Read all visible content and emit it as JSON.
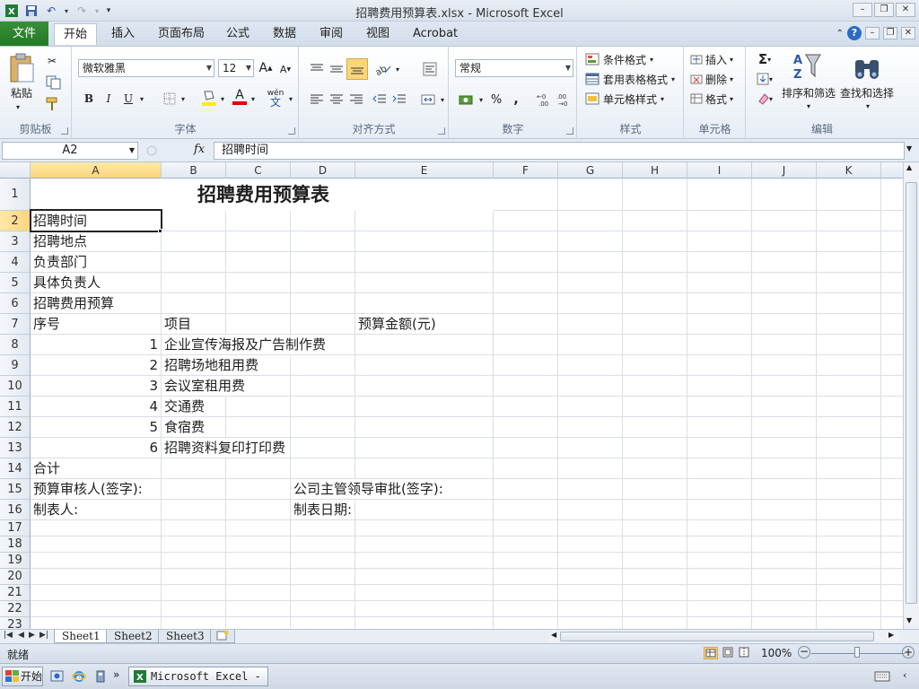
{
  "window": {
    "title": "招聘费用预算表.xlsx - Microsoft Excel"
  },
  "ribbon": {
    "tabs": [
      "文件",
      "开始",
      "插入",
      "页面布局",
      "公式",
      "数据",
      "审阅",
      "视图",
      "Acrobat"
    ],
    "active_tab": "开始",
    "clipboard": {
      "paste": "粘贴",
      "label": "剪贴板"
    },
    "font": {
      "name": "微软雅黑",
      "size": "12",
      "bold": "B",
      "italic": "I",
      "underline": "U",
      "label": "字体",
      "grow": "A",
      "shrink": "A",
      "color_a": "A",
      "wen": "wén"
    },
    "alignment": {
      "label": "对齐方式"
    },
    "number": {
      "format": "常规",
      "percent": "%",
      "comma": ",",
      "label": "数字"
    },
    "styles": {
      "conditional": "条件格式",
      "table": "套用表格格式",
      "cell_styles": "单元格样式",
      "label": "样式"
    },
    "cells": {
      "insert": "插入",
      "delete": "删除",
      "format": "格式",
      "label": "单元格"
    },
    "editing": {
      "sigma": "Σ",
      "sort": "排序和筛选",
      "find": "查找和选择",
      "label": "编辑"
    }
  },
  "formula_bar": {
    "name_box": "A2",
    "fx": "fx",
    "value": "招聘时间"
  },
  "grid": {
    "columns": [
      "A",
      "B",
      "C",
      "D",
      "E",
      "F",
      "G",
      "H",
      "I",
      "J",
      "K"
    ],
    "rows": [
      "1",
      "2",
      "3",
      "4",
      "5",
      "6",
      "7",
      "8",
      "9",
      "10",
      "11",
      "12",
      "13",
      "14",
      "15",
      "16",
      "17",
      "18",
      "19",
      "20",
      "21",
      "22",
      "23"
    ],
    "cells": {
      "title": "招聘费用预算表",
      "a2": "招聘时间",
      "a3": "招聘地点",
      "a4": "负责部门",
      "a5": "具体负责人",
      "a6": "招聘费用预算",
      "a7": "序号",
      "b7": "项目",
      "e7": "预算金额(元)",
      "items": [
        {
          "no": "1",
          "name": "企业宣传海报及广告制作费"
        },
        {
          "no": "2",
          "name": "招聘场地租用费"
        },
        {
          "no": "3",
          "name": "会议室租用费"
        },
        {
          "no": "4",
          "name": "交通费"
        },
        {
          "no": "5",
          "name": "食宿费"
        },
        {
          "no": "6",
          "name": "招聘资料复印打印费"
        }
      ],
      "a14": "合计",
      "a15": "预算审核人(签字):",
      "d15": "公司主管领导审批(签字):",
      "a16": "制表人:",
      "d16": "制表日期:"
    }
  },
  "sheets": [
    "Sheet1",
    "Sheet2",
    "Sheet3"
  ],
  "active_sheet": "Sheet1",
  "status": {
    "text": "就绪",
    "zoom": "100%"
  },
  "taskbar": {
    "start": "开始",
    "excel_task": "Microsoft Excel - ..."
  },
  "colors": {
    "file_tab": "#2a8a2a",
    "selection_header": "#fbd57c",
    "grid_line": "#d9dee6"
  }
}
